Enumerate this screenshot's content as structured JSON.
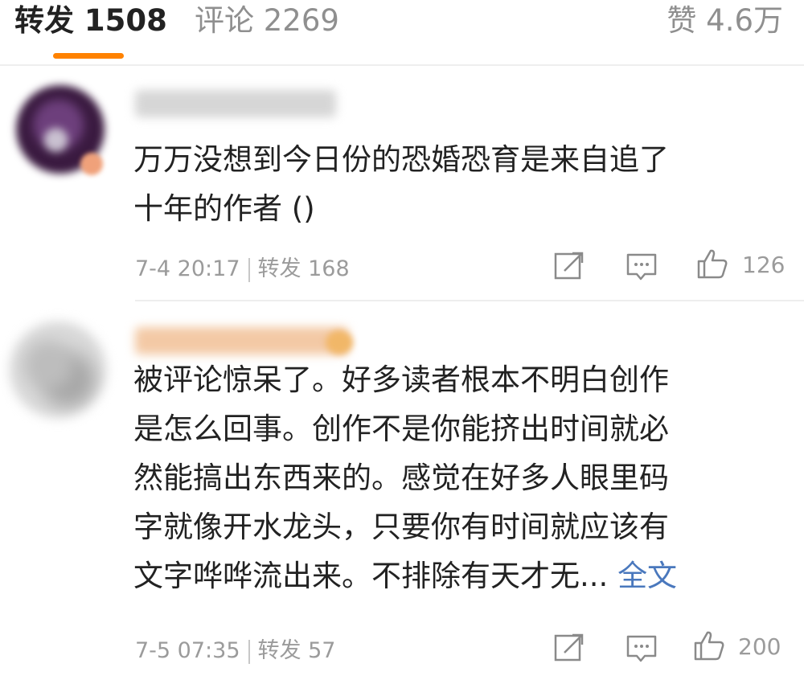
{
  "tabs": {
    "repost": "转发 1508",
    "comment": "评论 2269",
    "like": "赞 4.6万"
  },
  "colors": {
    "accent": "#ff8200",
    "link": "#4a78bd",
    "meta": "#9b9b9b"
  },
  "comments": [
    {
      "text_lines": [
        "万万没想到今日份的恐婚恐育是来自追了",
        "十年的作者 ()"
      ],
      "date": "7-4 20:17",
      "repost_label": "转发 168",
      "likes": "126"
    },
    {
      "text_lines": [
        "被评论惊呆了。好多读者根本不明白创作",
        "是怎么回事。创作不是你能挤出时间就必",
        "然能搞出东西来的。感觉在好多人眼里码",
        "字就像开水龙头，只要你有时间就应该有",
        "文字哗哗流出来。不排除有天才无..."
      ],
      "full_text_link": "全文",
      "date": "7-5 07:35",
      "repost_label": "转发 57",
      "likes": "200"
    }
  ],
  "icons": {
    "share": "share-icon",
    "reply": "comment-icon",
    "like": "thumbs-up-icon"
  }
}
